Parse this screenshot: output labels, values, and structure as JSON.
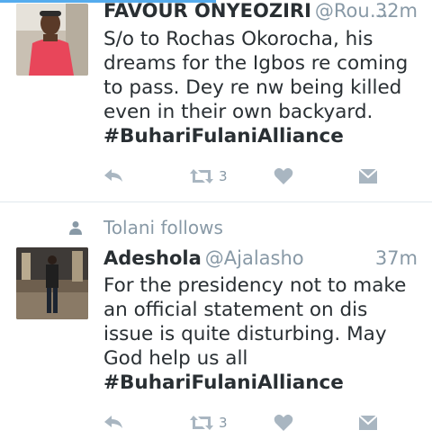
{
  "tweets": [
    {
      "name": "FAVOUR ONYEOZIRI",
      "handle": "@Rou…",
      "time": "32m",
      "text": "S/o to Rochas Okorocha, his dreams for the Igbos re coming to pass. Dey re nw being killed even in their own backyard.",
      "hashtag": "#BuhariFulaniAlliance",
      "retweet_count": "3"
    },
    {
      "context": "Tolani follows",
      "name": "Adeshola",
      "handle": "@Ajalasho",
      "time": "37m",
      "text": "For the presidency not to make an official statement on dis issue is quite disturbing. May God help us all",
      "hashtag": "#BuhariFulaniAlliance",
      "retweet_count": "3"
    }
  ],
  "icons": {
    "reply": "reply-icon",
    "retweet": "retweet-icon",
    "like": "heart-icon",
    "dm": "envelope-icon",
    "follow": "person-icon"
  },
  "colors": {
    "text": "#292f33",
    "secondary": "#8899a6",
    "accent": "#55acee",
    "divider": "#e1e8ed"
  }
}
